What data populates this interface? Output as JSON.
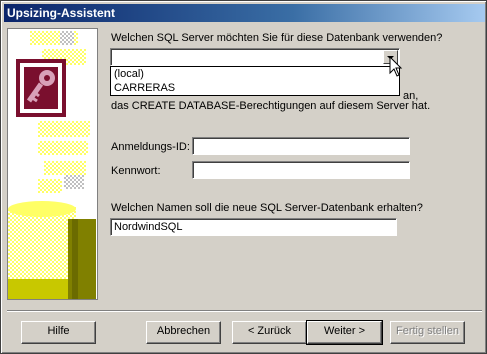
{
  "window": {
    "title": "Upsizing-Assistent"
  },
  "server": {
    "question": "Welchen SQL Server möchten Sie für diese Datenbank verwenden?",
    "selected": "",
    "options": [
      "(local)",
      "CARRERAS"
    ],
    "hint_line1_visible": "an,",
    "hint_line2": "das CREATE DATABASE-Berechtigungen auf diesem Server hat."
  },
  "login": {
    "id_label": "Anmeldungs-ID:",
    "id_value": "",
    "password_label": "Kennwort:",
    "password_value": ""
  },
  "database": {
    "question": "Welchen Namen soll die neue SQL Server-Datenbank erhalten?",
    "name_value": "NordwindSQL"
  },
  "buttons": {
    "help": "Hilfe",
    "cancel": "Abbrechen",
    "back": "< Zurück",
    "next": "Weiter >",
    "finish": "Fertig stellen"
  },
  "colors": {
    "titlebar": "#0a246a",
    "face": "#d4d0c8",
    "key_maroon": "#7a0f2e",
    "wizard_yellow": "#ffff66"
  }
}
